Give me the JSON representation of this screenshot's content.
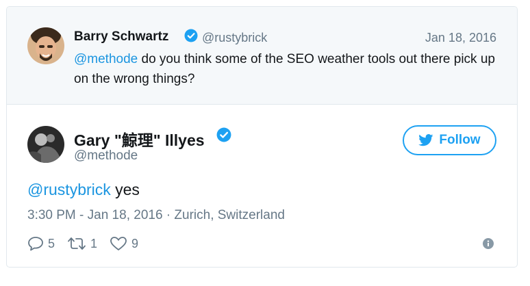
{
  "parent_tweet": {
    "author_name": "Barry Schwartz",
    "handle": "@rustybrick",
    "date": "Jan 18, 2016",
    "mention": "@methode",
    "text": " do you think some of the SEO weather tools out there pick up on the wrong things?"
  },
  "main_tweet": {
    "author_name": "Gary \"鯨理\" Illyes",
    "handle": "@methode",
    "follow_label": "Follow",
    "mention": "@rustybrick",
    "text": " yes",
    "meta": "3:30 PM - Jan 18, 2016 · Zurich, Switzerland",
    "reply_count": "5",
    "retweet_count": "1",
    "like_count": "9"
  },
  "colors": {
    "accent": "#1da1f2",
    "link": "#1b95e0",
    "muted": "#657786",
    "background_parent": "#f5f8fa"
  },
  "icons": [
    "verified-badge-icon",
    "twitter-bird-icon",
    "reply-icon",
    "retweet-icon",
    "like-heart-icon",
    "info-icon"
  ]
}
